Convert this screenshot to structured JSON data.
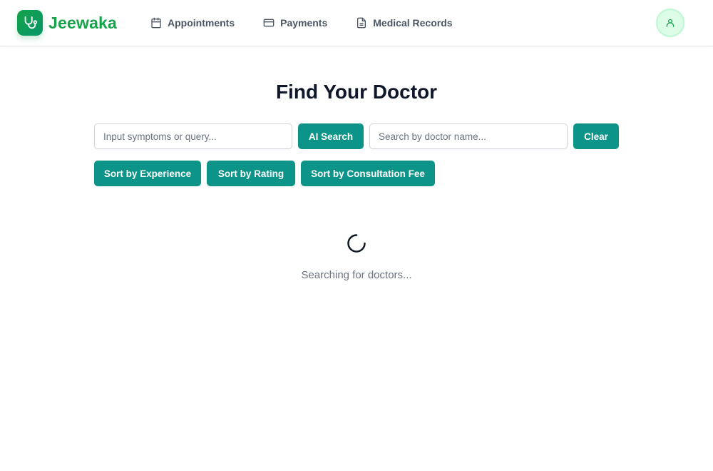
{
  "brand": {
    "name": "Jeewaka",
    "logo_icon": "stethoscope-icon",
    "color": "#16a34a"
  },
  "nav": {
    "items": [
      {
        "label": "Appointments",
        "icon": "calendar-icon"
      },
      {
        "label": "Payments",
        "icon": "credit-card-icon"
      },
      {
        "label": "Medical Records",
        "icon": "document-icon"
      }
    ]
  },
  "user": {
    "avatar_icon": "user-icon"
  },
  "main": {
    "title": "Find Your Doctor",
    "symptom_search": {
      "placeholder": "Input symptoms or query...",
      "value": ""
    },
    "ai_search_label": "AI Search",
    "doctor_search": {
      "placeholder": "Search by doctor name...",
      "value": ""
    },
    "clear_label": "Clear",
    "sort_buttons": [
      {
        "label": "Sort by Experience"
      },
      {
        "label": "Sort by Rating"
      },
      {
        "label": "Sort by Consultation Fee"
      }
    ],
    "loading_text": "Searching for doctors..."
  },
  "colors": {
    "accent": "#0d9488",
    "brand": "#16a34a",
    "text_muted": "#6b7280"
  }
}
